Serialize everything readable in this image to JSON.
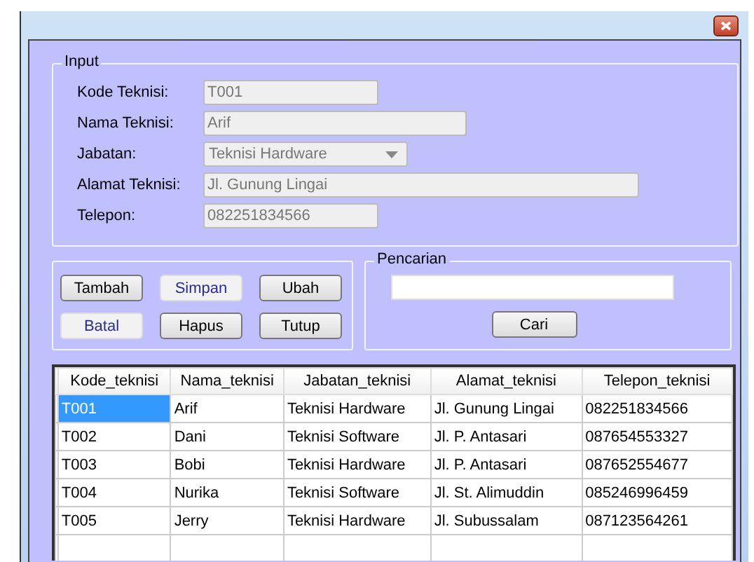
{
  "input_group": {
    "title": "Input",
    "fields": [
      {
        "label": "Kode Teknisi:",
        "value": "T001",
        "kind": "text"
      },
      {
        "label": "Nama Teknisi:",
        "value": "Arif",
        "kind": "text"
      },
      {
        "label": "Jabatan:",
        "value": "Teknisi Hardware",
        "kind": "dropdown"
      },
      {
        "label": "Alamat Teknisi:",
        "value": "Jl. Gunung Lingai",
        "kind": "text"
      },
      {
        "label": "Telepon:",
        "value": "082251834566",
        "kind": "text"
      }
    ]
  },
  "buttons": [
    {
      "label": "Tambah",
      "disabled": false
    },
    {
      "label": "Simpan",
      "disabled": true
    },
    {
      "label": "Ubah",
      "disabled": false
    },
    {
      "label": "Batal",
      "disabled": true
    },
    {
      "label": "Hapus",
      "disabled": false
    },
    {
      "label": "Tutup",
      "disabled": false
    }
  ],
  "search_group": {
    "title": "Pencarian",
    "button": "Cari"
  },
  "table": {
    "columns": [
      "Kode_teknisi",
      "Nama_teknisi",
      "Jabatan_teknisi",
      "Alamat_teknisi",
      "Telepon_teknisi"
    ],
    "rows": [
      {
        "selected": true,
        "cells": [
          "T001",
          "Arif",
          "Teknisi Hardware",
          "Jl. Gunung Lingai",
          "082251834566"
        ]
      },
      {
        "selected": false,
        "cells": [
          "T002",
          "Dani",
          "Teknisi Software",
          "Jl. P. Antasari",
          "087654553327"
        ]
      },
      {
        "selected": false,
        "cells": [
          "T003",
          "Bobi",
          "Teknisi Hardware",
          "Jl. P. Antasari",
          "087652554677"
        ]
      },
      {
        "selected": false,
        "cells": [
          "T004",
          "Nurika",
          "Teknisi Software",
          "Jl. St. Alimuddin",
          "085246996459"
        ]
      },
      {
        "selected": false,
        "cells": [
          "T005",
          "Jerry",
          "Teknisi Hardware",
          "Jl. Subussalam",
          "087123564261"
        ]
      }
    ]
  }
}
